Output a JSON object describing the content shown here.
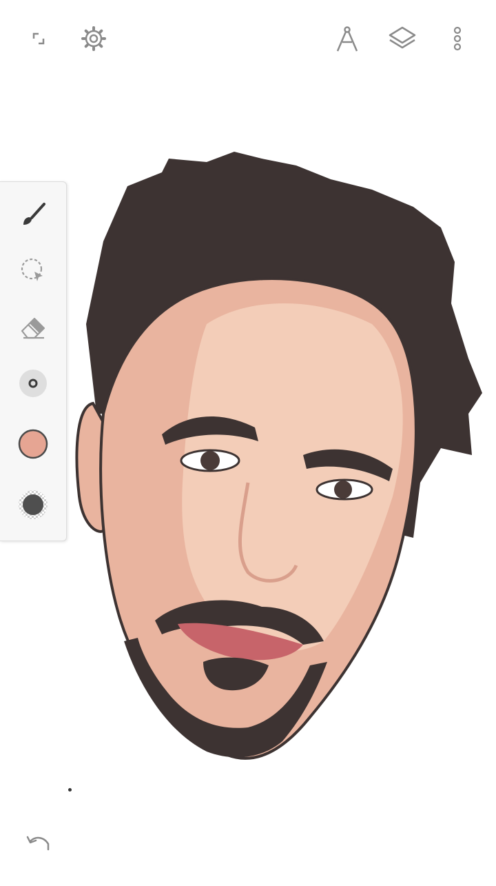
{
  "colors": {
    "icon": "#8a8a8a",
    "icon_active": "#3a3a3a",
    "current_color": "#e6a593",
    "opacity_swatch": "#4f4f4f",
    "hair": "#3d3332",
    "skin_base": "#e9b49f",
    "skin_light": "#f3cdb8",
    "lips": "#c7646a"
  },
  "topbar": {
    "fullscreen_icon": "fullscreen-icon",
    "settings_icon": "gear-icon",
    "perspective_icon": "compass-icon",
    "layers_icon": "layers-icon",
    "more_icon": "more-vertical-icon"
  },
  "toolbox": {
    "tools": [
      "brush-icon",
      "lasso-select-icon",
      "eraser-icon",
      "brush-size-icon",
      "color-swatch",
      "opacity-swatch"
    ]
  },
  "bottom": {
    "undo_icon": "undo-icon"
  }
}
